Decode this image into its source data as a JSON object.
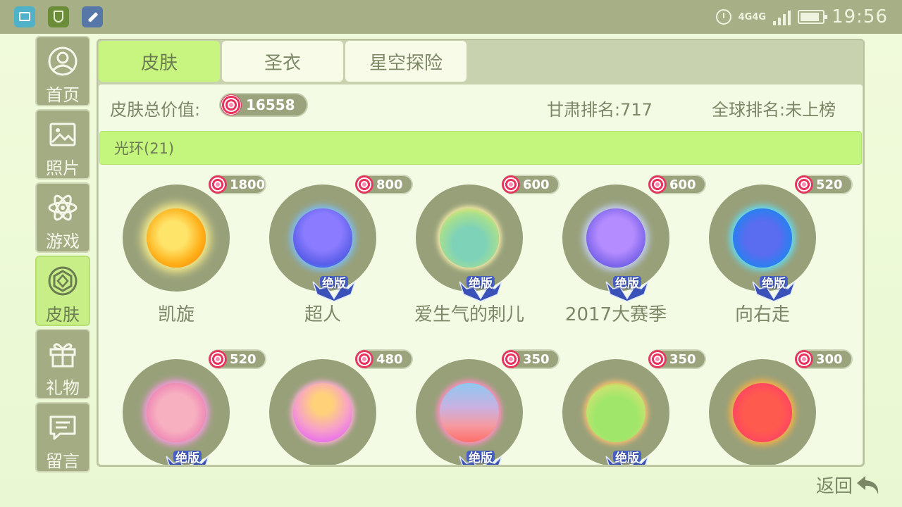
{
  "status_bar": {
    "network": "4G4G",
    "time": "19:56",
    "icons": [
      "gallery-icon",
      "shield-icon",
      "tool-icon",
      "alarm-icon",
      "signal-icon",
      "battery-icon"
    ]
  },
  "sidebar": {
    "items": [
      {
        "label": "首页",
        "icon": "user-icon",
        "active": false
      },
      {
        "label": "照片",
        "icon": "photo-icon",
        "active": false
      },
      {
        "label": "游戏",
        "icon": "atom-icon",
        "active": false
      },
      {
        "label": "皮肤",
        "icon": "gem-icon",
        "active": true
      },
      {
        "label": "礼物",
        "icon": "gift-icon",
        "active": false
      },
      {
        "label": "留言",
        "icon": "message-icon",
        "active": false
      }
    ]
  },
  "tabs": [
    {
      "label": "皮肤",
      "active": true
    },
    {
      "label": "圣衣",
      "active": false
    },
    {
      "label": "星空探险",
      "active": false
    }
  ],
  "summary": {
    "total_label": "皮肤总价值:",
    "total_value": "16558",
    "province_rank": "甘肃排名:717",
    "global_rank": "全球排名:未上榜"
  },
  "section": {
    "title": "光环(21)"
  },
  "items": [
    {
      "name": "凯旋",
      "price": "1800",
      "limited": false,
      "badge": ""
    },
    {
      "name": "超人",
      "price": "800",
      "limited": true,
      "badge": "绝版"
    },
    {
      "name": "爱生气的刺儿",
      "price": "600",
      "limited": true,
      "badge": "绝版"
    },
    {
      "name": "2017大赛季",
      "price": "600",
      "limited": true,
      "badge": "绝版"
    },
    {
      "name": "向右走",
      "price": "520",
      "limited": true,
      "badge": "绝版"
    },
    {
      "name": "",
      "price": "520",
      "limited": true,
      "badge": "绝版"
    },
    {
      "name": "",
      "price": "480",
      "limited": false,
      "badge": ""
    },
    {
      "name": "",
      "price": "350",
      "limited": true,
      "badge": "绝版"
    },
    {
      "name": "",
      "price": "350",
      "limited": true,
      "badge": "绝版"
    },
    {
      "name": "",
      "price": "300",
      "limited": false,
      "badge": ""
    }
  ],
  "back_button": {
    "label": "返回"
  },
  "colors": {
    "accent_green": "#c7f57f",
    "panel_olive": "#c9d2ae",
    "candy_red": "#e8335c",
    "badge_blue": "#2c3e8c"
  }
}
